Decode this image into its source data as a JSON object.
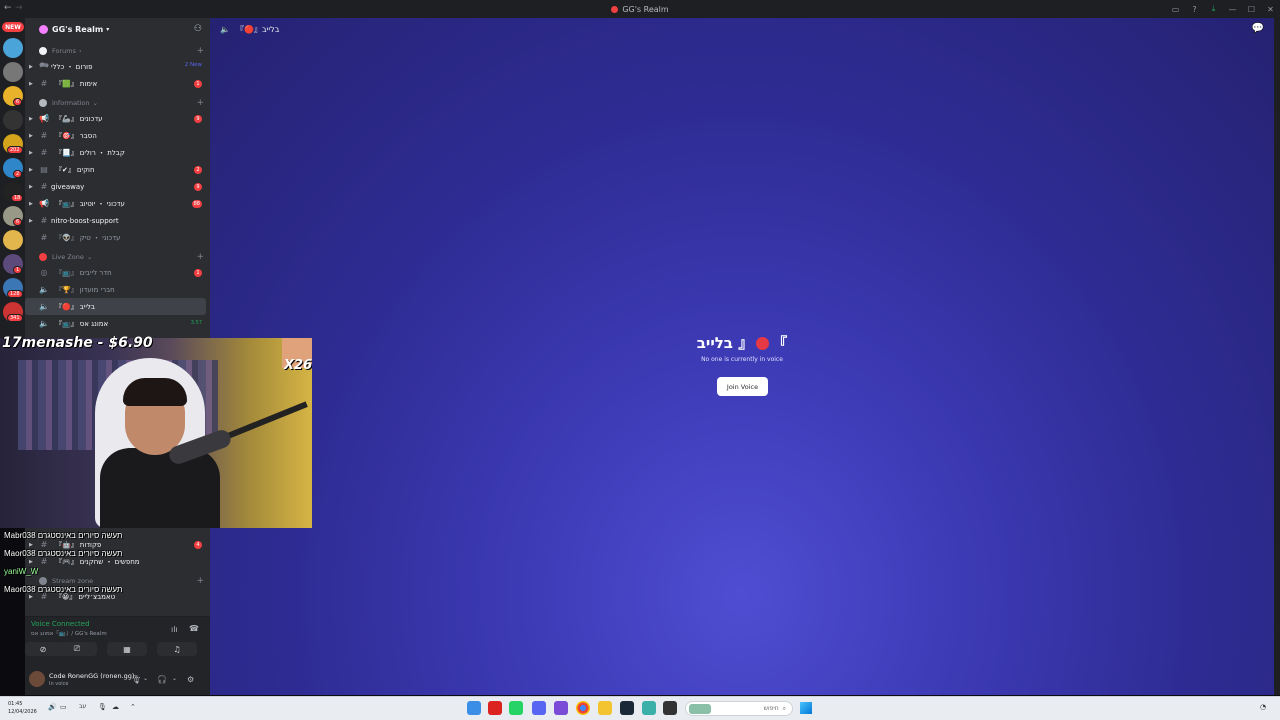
{
  "window": {
    "title": "GG's Realm"
  },
  "rail": {
    "new_label": "NEW",
    "badges": [
      "6",
      "202",
      "2",
      "18",
      "6",
      "1",
      "128",
      "341"
    ]
  },
  "guild": {
    "name": "GG's Realm"
  },
  "sidebar": {
    "categories": {
      "forums": "Forums",
      "information": "information",
      "live_zone": "Live Zone",
      "stream_zone": "Stream zone"
    },
    "channels": {
      "forum": {
        "name": "פורום ・ כללי",
        "badge": "2 New"
      },
      "verify": {
        "name": "אימות",
        "emoji": "『🟩』",
        "count": "1"
      },
      "updates": {
        "name": "עדכונים",
        "emoji": "『🦾』",
        "count": "9"
      },
      "explain": {
        "name": "הסבר",
        "emoji": "『🎯』"
      },
      "roles": {
        "name": "קבלת ・ רולים",
        "emoji": "『📃』"
      },
      "rules": {
        "name": "חוקים",
        "emoji": "『✔』",
        "count": "2"
      },
      "giveaway": {
        "name": "giveaway",
        "count": "9"
      },
      "youtube": {
        "name": "עדכוני ・ יוטיוב",
        "emoji": "『📺』",
        "count": "88"
      },
      "nitro": {
        "name": "nitro-boost-support"
      },
      "tiktok": {
        "name": "עדכוני ・ טיק",
        "emoji": "『👽』"
      },
      "live_room": {
        "name": "חדר לייבים",
        "emoji": "『📺』",
        "count": "1"
      },
      "club": {
        "name": "חברי מועדון",
        "emoji": "『🏆』"
      },
      "live": {
        "name": "בלייב",
        "emoji": "『🔴』"
      },
      "among": {
        "name": "אמונג אס",
        "emoji": "『📺』",
        "time": "3:57"
      },
      "commands": {
        "name": "פקודות",
        "emoji": "『🤖』",
        "count": "4"
      },
      "players": {
        "name": "מחפשים ・ שחקנים",
        "emoji": "『🎮』"
      },
      "tiktokers": {
        "name": "טאמבצ׳ליים",
        "emoji": "『😀』"
      }
    }
  },
  "voice_panel": {
    "status": "Voice Connected",
    "location": "אמונג אס『📺』/ GG's Realm"
  },
  "user_panel": {
    "name": "Code RonenGG (ronen.gg)...",
    "status": "In voice"
  },
  "main": {
    "header_title": "בלייב",
    "header_emoji": "『🔴』",
    "voice_channel_name": "בלייב",
    "empty_text": "No one is currently in voice",
    "join_button": "Join Voice"
  },
  "stream_overlay": {
    "donation": "17menashe - $6.90",
    "multiplier": "X26",
    "chat": [
      "Mabr038 תעשה סיורים באינסטגרם",
      "Maor038 תעשה סיורים באינסטגרם",
      "yaniW_W",
      "Maor038 תעשה סיורים באינסטגרם"
    ]
  },
  "taskbar": {
    "time": "01:45",
    "date": "12/04/2026",
    "lang": "עב",
    "search_placeholder": "חיפוש"
  },
  "colors": {
    "accent": "#5865f2",
    "voice_green": "#23a55a",
    "badge_red": "#f23f42",
    "main_bg": "#3d3ab5"
  }
}
